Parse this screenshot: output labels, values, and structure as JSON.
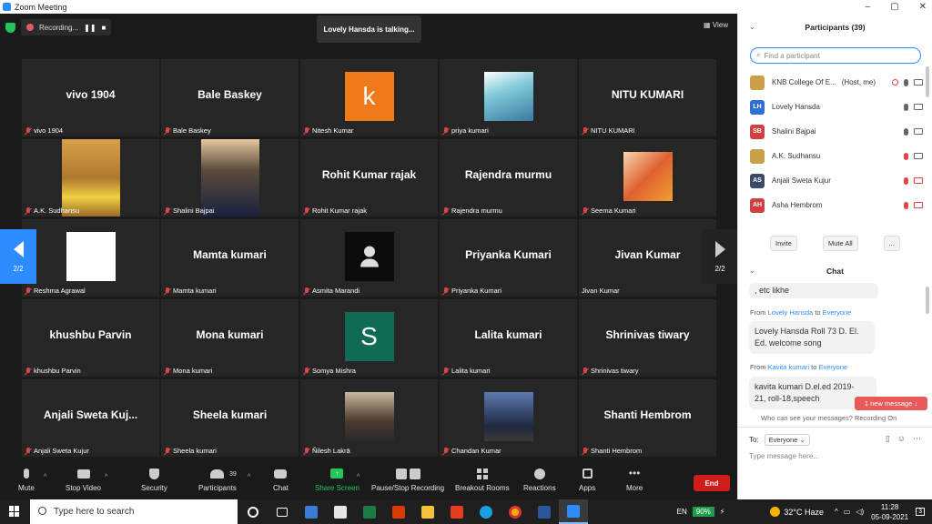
{
  "window": {
    "title": "Zoom Meeting",
    "controls": [
      "–",
      "▢",
      "✕"
    ]
  },
  "topbar": {
    "recording_label": "Recording...",
    "talking_text": "Lovely Hansda is talking...",
    "view_label": "View"
  },
  "grid": {
    "tiles": [
      {
        "big": "vivo 1904",
        "label": "vivo 1904",
        "kind": "name"
      },
      {
        "big": "Bale Baskey",
        "label": "Bale Baskey",
        "kind": "name"
      },
      {
        "big": "k",
        "label": "Nitesh Kumar",
        "kind": "letter",
        "color": "#f07a1a"
      },
      {
        "big": "",
        "label": "priya kumari",
        "kind": "photo-priya"
      },
      {
        "big": "NITU KUMARI",
        "label": "NITU KUMARI",
        "kind": "name"
      },
      {
        "big": "",
        "label": "A.K. Sudhansu",
        "kind": "photo-ak"
      },
      {
        "big": "",
        "label": "Shalini Bajpai",
        "kind": "photo-shalini"
      },
      {
        "big": "Rohit Kumar rajak",
        "label": "Rohit Kumar rajak",
        "kind": "name"
      },
      {
        "big": "Rajendra murmu",
        "label": "Rajendra murmu",
        "kind": "name"
      },
      {
        "big": "",
        "label": "Seema Kumari",
        "kind": "photo-seema"
      },
      {
        "big": "",
        "label": "Reshma Agrawal",
        "kind": "photo-reshma"
      },
      {
        "big": "Mamta kumari",
        "label": "Mamta kumari",
        "kind": "name"
      },
      {
        "big": "",
        "label": "Asmita Marandi",
        "kind": "photo-asmita"
      },
      {
        "big": "Priyanka Kumari",
        "label": "Priyanka Kumari",
        "kind": "name"
      },
      {
        "big": "Jivan Kumar",
        "label": "Jivan Kumar",
        "kind": "name-unmuted"
      },
      {
        "big": "khushbu Parvin",
        "label": "khushbu Parvin",
        "kind": "name"
      },
      {
        "big": "Mona kumari",
        "label": "Mona kumari",
        "kind": "name"
      },
      {
        "big": "S",
        "label": "Somya Mishra",
        "kind": "letter",
        "color": "#0f6b54"
      },
      {
        "big": "Lalita kumari",
        "label": "Lalita kumari",
        "kind": "name"
      },
      {
        "big": "Shrinivas tiwary",
        "label": "Shrinivas tiwary",
        "kind": "name"
      },
      {
        "big": "Anjali  Sweta  Kuj...",
        "label": "Anjali Sweta Kujur",
        "kind": "name"
      },
      {
        "big": "Sheela kumari",
        "label": "Sheela kumari",
        "kind": "name"
      },
      {
        "big": "",
        "label": "Ñilesh Lakrā",
        "kind": "photo-nilesh"
      },
      {
        "big": "",
        "label": "Chandan Kumar",
        "kind": "photo-chandan"
      },
      {
        "big": "Shanti Hembrom",
        "label": "Shanti Hembrom",
        "kind": "name"
      }
    ],
    "page_left": "2/2",
    "page_right": "2/2"
  },
  "toolbar": {
    "mute": "Mute",
    "stop_video": "Stop Video",
    "security": "Security",
    "participants": "Participants",
    "participants_count": "39",
    "chat": "Chat",
    "share_screen": "Share Screen",
    "recording": "Pause/Stop Recording",
    "breakout": "Breakout Rooms",
    "reactions": "Reactions",
    "apps": "Apps",
    "more": "More",
    "end": "End"
  },
  "participants_panel": {
    "title": "Participants (39)",
    "search_placeholder": "Find a participant",
    "list": [
      {
        "initials": "",
        "name": "KNB College Of E...",
        "suffix": "(Host, me)",
        "color": "#c8a048",
        "mic": "on",
        "cam": "on"
      },
      {
        "initials": "LH",
        "name": "Lovely Hansda",
        "suffix": "",
        "color": "#2d6fd6",
        "mic": "on",
        "cam": "on"
      },
      {
        "initials": "SB",
        "name": "Shalini Bajpai",
        "suffix": "",
        "color": "#d04040",
        "mic": "on",
        "cam": "on"
      },
      {
        "initials": "",
        "name": "A.K. Sudhansu",
        "suffix": "",
        "color": "#c8a048",
        "mic": "muted",
        "cam": "on"
      },
      {
        "initials": "AS",
        "name": "Anjali Sweta Kujur",
        "suffix": "",
        "color": "#3a4a6a",
        "mic": "muted",
        "cam": "off"
      },
      {
        "initials": "AH",
        "name": "Asha Hembrom",
        "suffix": "",
        "color": "#d04040",
        "mic": "muted",
        "cam": "off"
      }
    ],
    "invite": "Invite",
    "mute_all": "Mute All",
    "more": "..."
  },
  "chat": {
    "title": "Chat",
    "msg0": ", etc likhe",
    "m1_prefix": "From",
    "m1_sender": "Lovely Hansda",
    "m1_to": "to",
    "m1_recipient": "Everyone",
    "m1_line1": "Lovely Hansda Roll 73 D. El.",
    "m1_line2": "Ed. welcome song",
    "m2_prefix": "From",
    "m2_sender": "Kavita kumari",
    "m2_to": "to",
    "m2_recipient": "Everyone",
    "m2_line1": "kavita kumari D.el.ed 2019-",
    "m2_line2": "21, roll-18,speech",
    "new_message": "1 new message ↓",
    "who_can_see": "Who can see your messages? Recording On",
    "to_label": "To:",
    "to_value": "Everyone",
    "input_placeholder": "Type message here..."
  },
  "taskbar": {
    "search_placeholder": "Type here to search",
    "lang": "EN",
    "battery": "90%",
    "weather": "32°C  Haze",
    "time": "11:28",
    "date": "05-09-2021",
    "notif": "3"
  }
}
